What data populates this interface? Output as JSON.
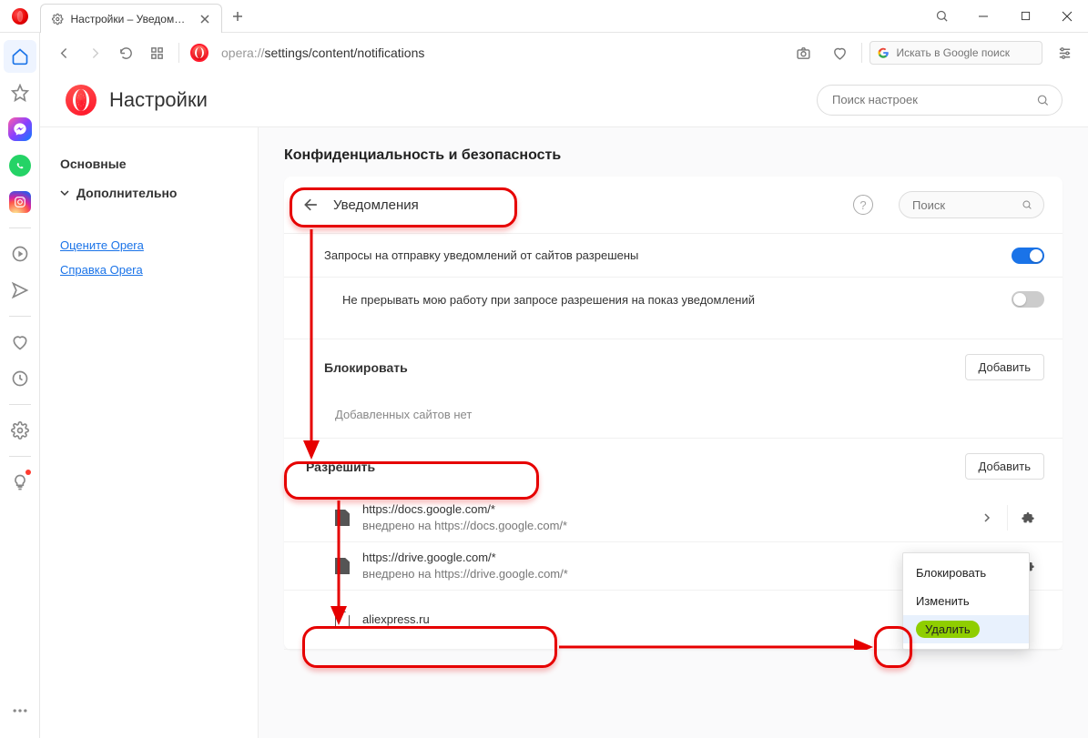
{
  "titlebar": {
    "tab_title": "Настройки – Уведомления"
  },
  "nav": {
    "url_prefix": "opera://",
    "url_path": "settings/content/notifications",
    "google_placeholder": "Искать в Google поиск"
  },
  "settings_header": {
    "title": "Настройки",
    "search_placeholder": "Поиск настроек"
  },
  "settings_nav": {
    "basic": "Основные",
    "advanced": "Дополнительно",
    "rate_link": "Оцените Opera",
    "help_link": "Справка Opera"
  },
  "page": {
    "section_title": "Конфиденциальность и безопасность",
    "notifications_label": "Уведомления",
    "search_placeholder": "Поиск",
    "ask_toggle_label": "Запросы на отправку уведомлений от сайтов разрешены",
    "quiet_toggle_label": "Не прерывать мою работу при запросе разрешения на показ уведомлений",
    "block_section": "Блокировать",
    "block_empty": "Добавленных сайтов нет",
    "allow_section": "Разрешить",
    "add_button": "Добавить",
    "sites": [
      {
        "url": "https://docs.google.com/*",
        "embedded": "внедрено на https://docs.google.com/*"
      },
      {
        "url": "https://drive.google.com/*",
        "embedded": "внедрено на https://drive.google.com/*"
      },
      {
        "url": "aliexpress.ru",
        "embedded": ""
      }
    ],
    "menu": {
      "block": "Блокировать",
      "edit": "Изменить",
      "delete": "Удалить"
    }
  }
}
